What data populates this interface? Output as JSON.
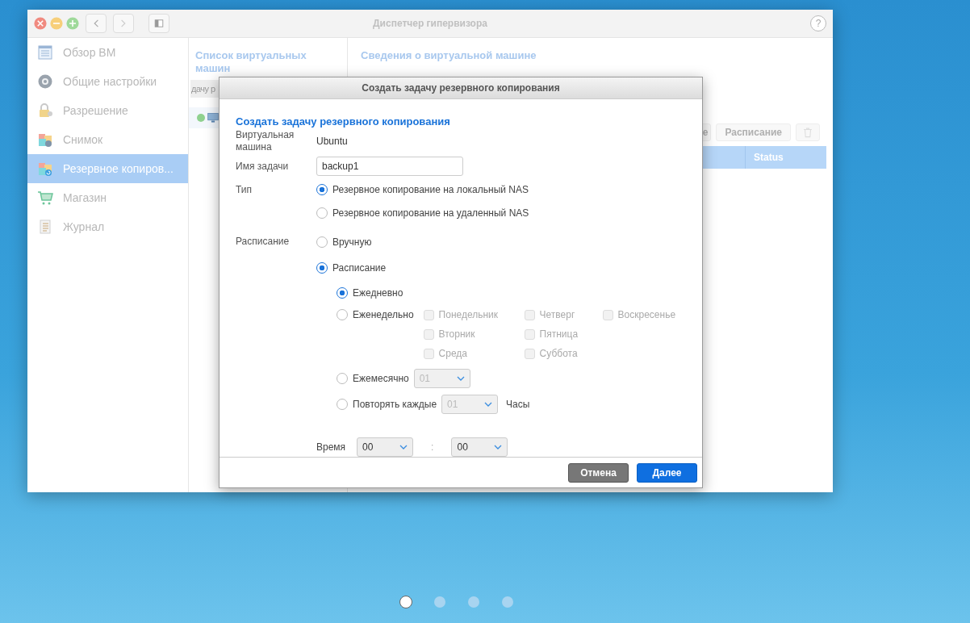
{
  "window": {
    "title": "Диспетчер гипервизора",
    "help": "?"
  },
  "sidebar": {
    "items": [
      {
        "label": "Обзор ВМ",
        "selected": false
      },
      {
        "label": "Общие настройки",
        "selected": false
      },
      {
        "label": "Разрешение",
        "selected": false
      },
      {
        "label": "Снимок",
        "selected": false
      },
      {
        "label": "Резервное копиров...",
        "selected": true
      },
      {
        "label": "Магазин",
        "selected": false
      },
      {
        "label": "Журнал",
        "selected": false
      }
    ]
  },
  "vm_list": {
    "title": "Список виртуальных машин",
    "search": {
      "value": "дачу р"
    },
    "rows": [
      {
        "color": "#8fd18f",
        "selected": true
      }
    ]
  },
  "details": {
    "title": "Сведения о виртуальной машине",
    "buttons": [
      {
        "label": "е",
        "kind": "text"
      },
      {
        "label": "Расписание",
        "kind": "text"
      },
      {
        "kind": "trash"
      }
    ],
    "table": {
      "columns": [
        {
          "label": "Status"
        }
      ]
    }
  },
  "dialog": {
    "title": "Создать задачу резервного копирования",
    "heading": "Создать задачу резервного копирования",
    "vm_label": "Виртуальная машина",
    "vm_value": "Ubuntu",
    "task_label": "Имя задачи",
    "task_value": "backup1",
    "type_label": "Тип",
    "type_options": [
      {
        "label": "Резервное копирование на локальный NAS",
        "selected": true
      },
      {
        "label": "Резервное копирование на удаленный NAS",
        "selected": false
      }
    ],
    "schedule_label": "Расписание",
    "schedule_options": [
      {
        "label": "Вручную",
        "selected": false
      },
      {
        "label": "Расписание",
        "selected": true
      }
    ],
    "frequency": [
      {
        "kind": "plain",
        "label": "Ежедневно",
        "selected": true
      },
      {
        "kind": "weekly",
        "label": "Еженедельно",
        "selected": false,
        "days": [
          {
            "label": "Понедельник",
            "checked": false,
            "disabled": true
          },
          {
            "label": "Вторник",
            "checked": false,
            "disabled": true
          },
          {
            "label": "Среда",
            "checked": false,
            "disabled": true
          },
          {
            "label": "Четверг",
            "checked": false,
            "disabled": true
          },
          {
            "label": "Пятница",
            "checked": false,
            "disabled": true
          },
          {
            "label": "Суббота",
            "checked": false,
            "disabled": true
          },
          {
            "label": "Воскресенье",
            "checked": false,
            "disabled": true
          }
        ]
      },
      {
        "kind": "select",
        "label": "Ежемесячно",
        "selected": false,
        "select": {
          "value": "01",
          "disabled": true
        }
      },
      {
        "kind": "select",
        "label": "Повторять каждые",
        "selected": false,
        "select": {
          "value": "01",
          "disabled": true
        },
        "unit": "Часы"
      }
    ],
    "time": {
      "label": "Время",
      "hour": "00",
      "separator": ":",
      "minute": "00"
    },
    "buttons": [
      {
        "label": "Отмена",
        "kind": "secondary"
      },
      {
        "label": "Далее",
        "kind": "primary"
      }
    ]
  },
  "pager": [
    {
      "selected": true
    },
    {
      "selected": false
    },
    {
      "selected": false
    },
    {
      "selected": false
    }
  ]
}
